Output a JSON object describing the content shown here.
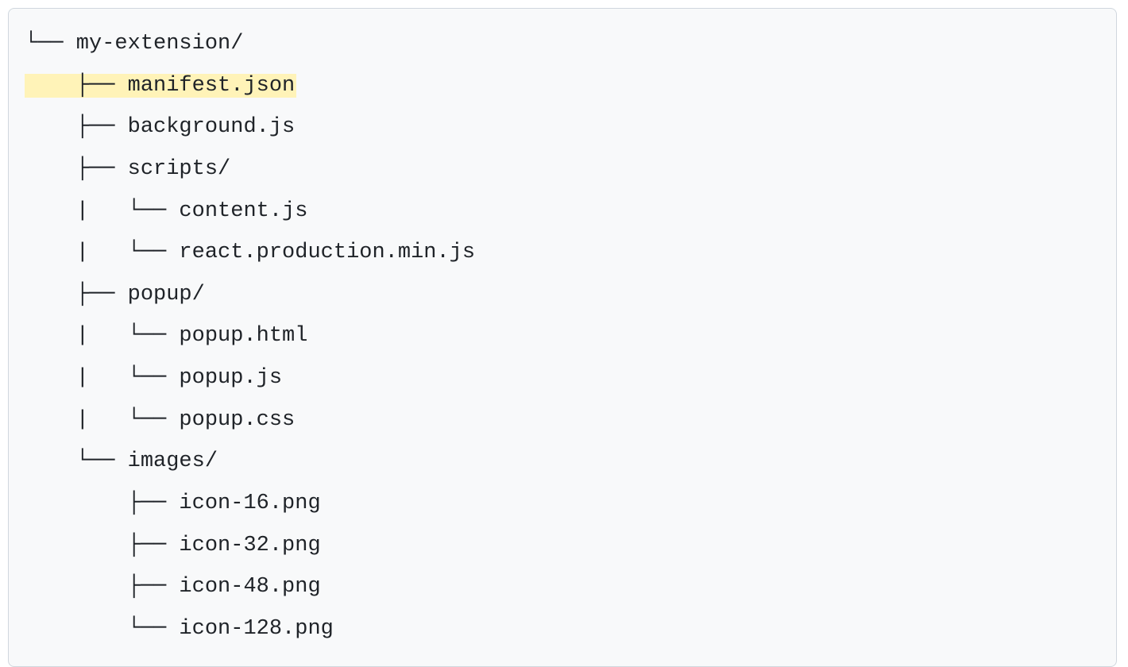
{
  "tree": {
    "lines": [
      {
        "prefix": "└── ",
        "name": "my-extension/",
        "highlighted": false
      },
      {
        "prefix": "    ├── ",
        "name": "manifest.json",
        "highlighted": true
      },
      {
        "prefix": "    ├── ",
        "name": "background.js",
        "highlighted": false
      },
      {
        "prefix": "    ├── ",
        "name": "scripts/",
        "highlighted": false
      },
      {
        "prefix": "    |   └── ",
        "name": "content.js",
        "highlighted": false
      },
      {
        "prefix": "    |   └── ",
        "name": "react.production.min.js",
        "highlighted": false
      },
      {
        "prefix": "    ├── ",
        "name": "popup/",
        "highlighted": false
      },
      {
        "prefix": "    |   └── ",
        "name": "popup.html",
        "highlighted": false
      },
      {
        "prefix": "    |   └── ",
        "name": "popup.js",
        "highlighted": false
      },
      {
        "prefix": "    |   └── ",
        "name": "popup.css",
        "highlighted": false
      },
      {
        "prefix": "    └── ",
        "name": "images/",
        "highlighted": false
      },
      {
        "prefix": "        ├── ",
        "name": "icon-16.png",
        "highlighted": false
      },
      {
        "prefix": "        ├── ",
        "name": "icon-32.png",
        "highlighted": false
      },
      {
        "prefix": "        ├── ",
        "name": "icon-48.png",
        "highlighted": false
      },
      {
        "prefix": "        └── ",
        "name": "icon-128.png",
        "highlighted": false
      }
    ]
  }
}
